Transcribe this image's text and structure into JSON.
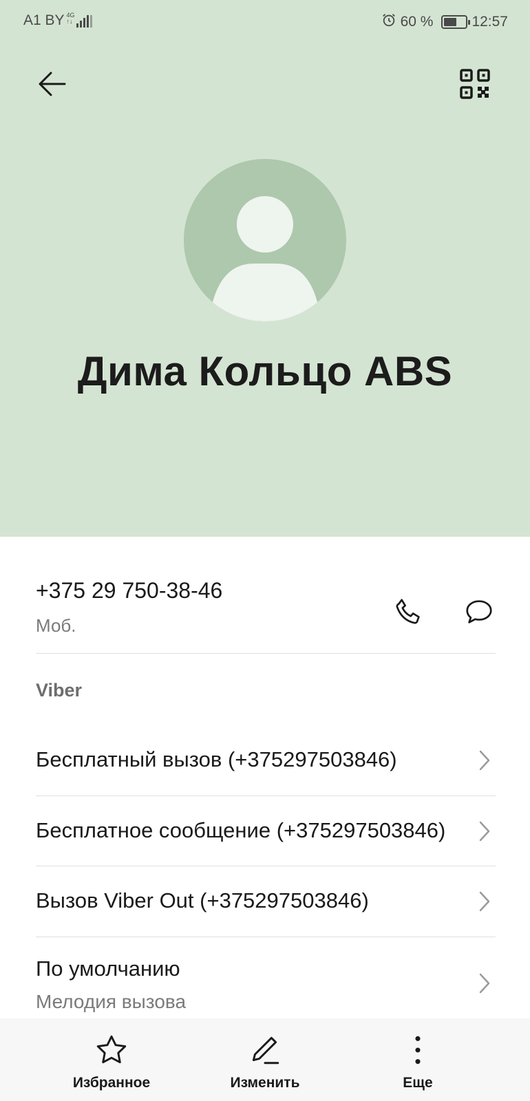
{
  "status_bar": {
    "carrier": "A1 BY",
    "network_badge_top": "4G",
    "network_badge_bottom": "↑↓",
    "battery_percent_text": "60 %",
    "battery_level": 0.6,
    "time": "12:57",
    "alarm_icon": "alarm-icon"
  },
  "header": {
    "back_icon": "arrow-left-icon",
    "qr_icon": "qr-code-icon",
    "contact_name": "Дима Кольцо ABS",
    "background": "#d4e4d2",
    "avatar_color": "#adc8ad"
  },
  "phone": {
    "number": "+375 29 750-38-46",
    "type": "Моб.",
    "call_icon": "phone-icon",
    "message_icon": "message-bubble-icon"
  },
  "viber": {
    "section_title": "Viber",
    "items": [
      {
        "label": "Бесплатный вызов (+375297503846)"
      },
      {
        "label": "Бесплатное сообщение (+375297503846)"
      },
      {
        "label": "Вызов Viber Out (+375297503846)"
      }
    ]
  },
  "ringtone": {
    "label": "По умолчанию",
    "sublabel": "Мелодия вызова"
  },
  "bottom_bar": {
    "tabs": [
      {
        "label": "Избранное",
        "icon": "star-icon"
      },
      {
        "label": "Изменить",
        "icon": "pencil-icon"
      },
      {
        "label": "Еще",
        "icon": "more-vertical-icon"
      }
    ]
  }
}
